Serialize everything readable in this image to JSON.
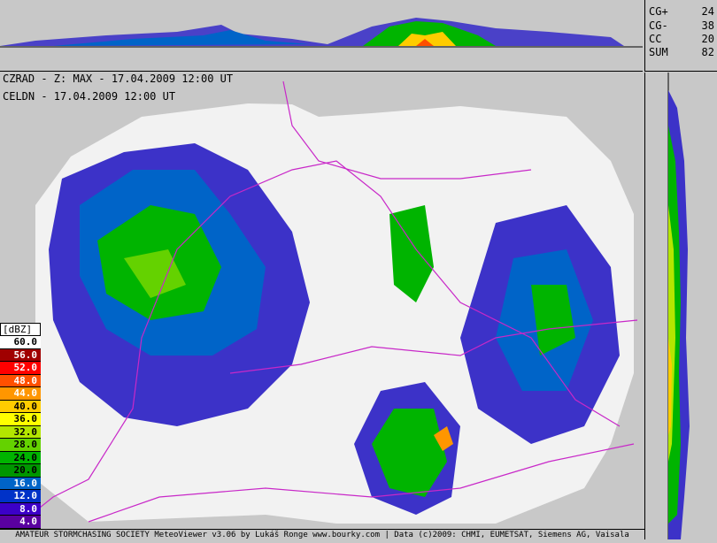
{
  "header": {
    "line1": "CZRAD - Z: MAX - 17.04.2009 12:00 UT",
    "line2": "CELDN - 17.04.2009 12:00 UT"
  },
  "lightning": [
    {
      "label": "CG+",
      "value": "24"
    },
    {
      "label": "CG-",
      "value": "38"
    },
    {
      "label": "CC",
      "value": "20"
    },
    {
      "label": "SUM",
      "value": "82"
    }
  ],
  "legend": {
    "title": "[dBZ]",
    "items": [
      {
        "label": "60.0",
        "color": "#ffffff",
        "text": "#000000"
      },
      {
        "label": "56.0",
        "color": "#a00000",
        "text": "#ffffff"
      },
      {
        "label": "52.0",
        "color": "#ff0000",
        "text": "#ffffff"
      },
      {
        "label": "48.0",
        "color": "#ff5000",
        "text": "#ffffff"
      },
      {
        "label": "44.0",
        "color": "#ff9600",
        "text": "#ffffff"
      },
      {
        "label": "40.0",
        "color": "#ffcc00",
        "text": "#000000"
      },
      {
        "label": "36.0",
        "color": "#ffff00",
        "text": "#000000"
      },
      {
        "label": "32.0",
        "color": "#b4e600",
        "text": "#000000"
      },
      {
        "label": "28.0",
        "color": "#64d200",
        "text": "#000000"
      },
      {
        "label": "24.0",
        "color": "#00b400",
        "text": "#000000"
      },
      {
        "label": "20.0",
        "color": "#009600",
        "text": "#000000"
      },
      {
        "label": "16.0",
        "color": "#0064c8",
        "text": "#ffffff"
      },
      {
        "label": "12.0",
        "color": "#0032c8",
        "text": "#ffffff"
      },
      {
        "label": "8.0",
        "color": "#3c00c8",
        "text": "#ffffff"
      },
      {
        "label": "4.0",
        "color": "#5a00a0",
        "text": "#ffffff"
      }
    ]
  },
  "footer": "AMATEUR STORMCHASING SOCIETY MeteoViewer v3.06 by Lukáš Ronge www.bourky.com | Data (c)2009: CHMI, EUMETSAT, Siemens AG, Vaisala"
}
